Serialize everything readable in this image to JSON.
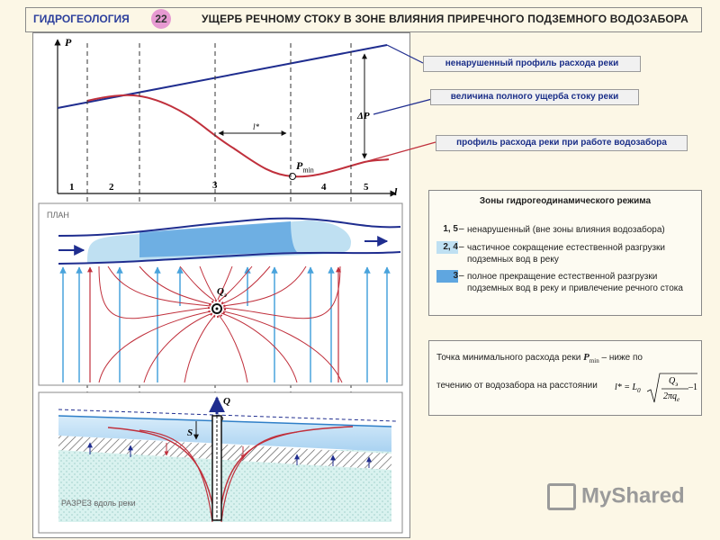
{
  "header": {
    "discipline": "ГИДРОГЕОЛОГИЯ",
    "slide_number": "22",
    "title": "УЩЕРБ РЕЧНОМУ СТОКУ В ЗОНЕ ВЛИЯНИЯ ПРИРЕЧНОГО ПОДЗЕМНОГО ВОДОЗАБОРА"
  },
  "callouts": {
    "undisturbed_profile": "ненарушенный профиль расхода реки",
    "total_damage": "величина полного ущерба стоку реки",
    "profile_with_intake": "профиль расхода реки при работе водозабора"
  },
  "graph": {
    "y_axis": "P",
    "x_axis": "l",
    "zone_numbers": [
      "1",
      "2",
      "3",
      "4",
      "5"
    ],
    "delta_p_label": "ΔP",
    "distance_label": "l*",
    "p_min_label": "P",
    "p_min_sub": "min"
  },
  "plan": {
    "label": "ПЛАН",
    "well_label": "Q",
    "well_sub": "э"
  },
  "section": {
    "label": "РАЗРЕЗ вдоль реки",
    "well_q": "Q",
    "drawdown": "S",
    "sub_e": "э"
  },
  "legend": {
    "title": "Зоны гидрогеодинамического режима",
    "items": [
      {
        "key": "1, 5",
        "text": "ненарушенный (вне зоны влияния водозабора)",
        "color": ""
      },
      {
        "key": "2, 4",
        "text": "частичное сокращение естественной разгрузки подземных вод в реку",
        "color": "#bfe0f2"
      },
      {
        "key": "3",
        "text": "полное прекращение естественной разгрузки подземных вод в реку и привлечение речного стока",
        "color": "#5fa6e0"
      }
    ]
  },
  "note": {
    "line1_start": "Точка минимального расхода реки",
    "pmin": "P",
    "pmin_sub": "min",
    "line1_end": "– ниже по",
    "line2": "течению от водозабора на расстоянии",
    "formula_lhs": "l* = L",
    "formula_lhs_sub": "0",
    "formula_num": "Q",
    "formula_num_sub": "э",
    "formula_den": "2πq",
    "formula_den_sub": "e",
    "formula_tail": "–1"
  },
  "logo": "MyShared"
}
